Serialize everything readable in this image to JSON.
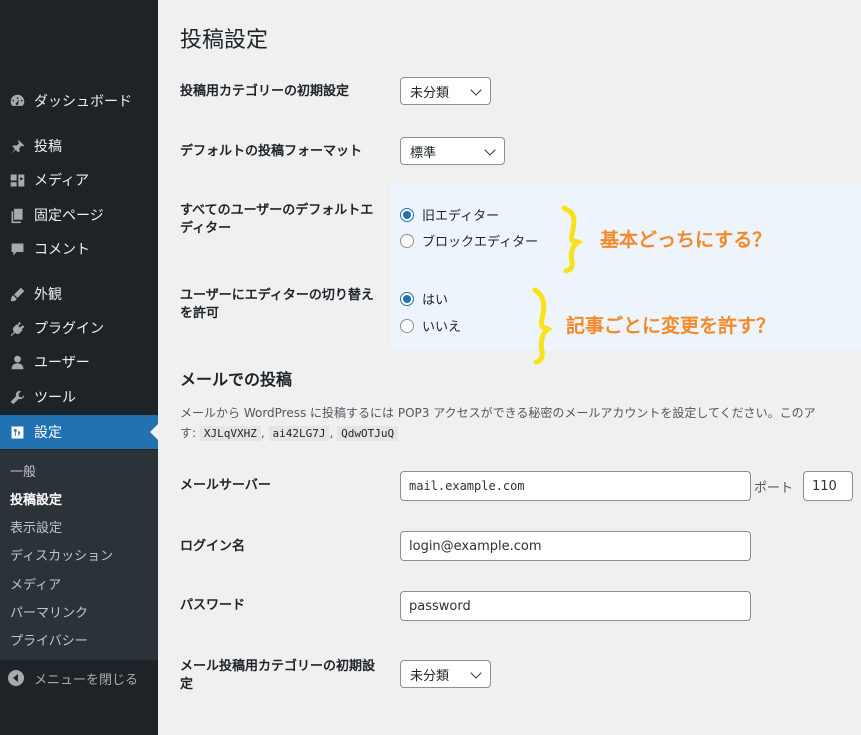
{
  "sidebar": {
    "items": [
      {
        "label": "ダッシュボード",
        "icon": "dashboard-icon"
      },
      {
        "label": "投稿",
        "icon": "pushpin-icon"
      },
      {
        "label": "メディア",
        "icon": "media-icon"
      },
      {
        "label": "固定ページ",
        "icon": "pages-icon"
      },
      {
        "label": "コメント",
        "icon": "comment-icon"
      },
      {
        "label": "外観",
        "icon": "brush-icon"
      },
      {
        "label": "プラグイン",
        "icon": "plugin-icon"
      },
      {
        "label": "ユーザー",
        "icon": "user-icon"
      },
      {
        "label": "ツール",
        "icon": "wrench-icon"
      },
      {
        "label": "設定",
        "icon": "settings-icon"
      }
    ],
    "submenu": [
      "一般",
      "投稿設定",
      "表示設定",
      "ディスカッション",
      "メディア",
      "パーマリンク",
      "プライバシー"
    ],
    "collapse_label": "メニューを閉じる"
  },
  "page": {
    "title": "投稿設定",
    "default_category_label": "投稿用カテゴリーの初期設定",
    "default_category_value": "未分類",
    "default_format_label": "デフォルトの投稿フォーマット",
    "default_format_value": "標準",
    "default_editor_label": "すべてのユーザーのデフォルトエディター",
    "editor_options": [
      "旧エディター",
      "ブロックエディター"
    ],
    "allow_switch_label": "ユーザーにエディターの切り替えを許可",
    "switch_options": [
      "はい",
      "いいえ"
    ],
    "annotation_1": "基本どっちにする？",
    "annotation_2": "記事ごとに変更を許す？",
    "annotation_color": "#f28a2c",
    "mail_heading": "メールでの投稿",
    "mail_desc": "メールから WordPress に投稿するには POP3 アクセスができる秘密のメールアカウントを設定してください。このア",
    "mail_desc_prefix": "す:",
    "secret_codes": [
      "XJLqVXHZ",
      "ai42LG7J",
      "QdwOTJuQ"
    ],
    "mail_server_label": "メールサーバー",
    "mail_server_value": "mail.example.com",
    "port_label": "ポート",
    "port_value": "110",
    "login_label": "ログイン名",
    "login_value": "login@example.com",
    "password_label": "パスワード",
    "password_value": "password",
    "mail_category_label": "メール投稿用カテゴリーの初期設定",
    "mail_category_value": "未分類"
  },
  "colors": {
    "accent": "#2271b1",
    "sidebar": "#1d2327"
  }
}
